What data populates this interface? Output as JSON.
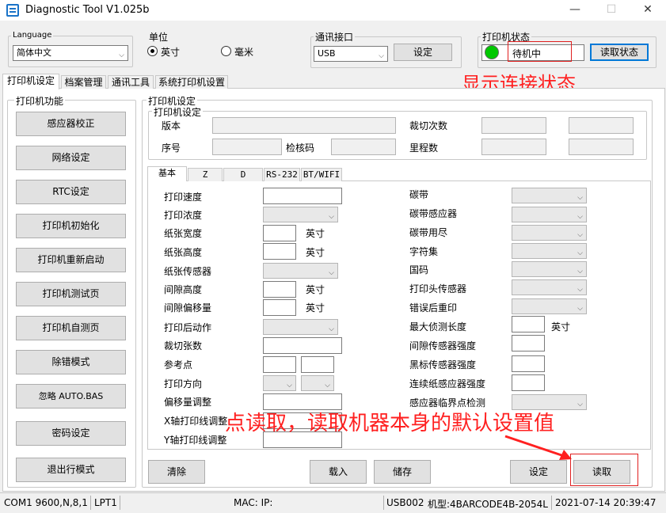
{
  "window": {
    "title": "Diagnostic Tool V1.025b",
    "min": "—",
    "max": "☐",
    "close": "✕"
  },
  "top": {
    "language": {
      "label": "Language",
      "value": "简体中文"
    },
    "unit": {
      "label": "单位",
      "inch": "英寸",
      "mm": "毫米",
      "selected": "inch"
    },
    "comm": {
      "label": "通讯接口",
      "value": "USB",
      "set_btn": "设定"
    },
    "status": {
      "label": "打印机状态",
      "value": "待机中",
      "read_btn": "读取状态",
      "led_color": "#00c800"
    }
  },
  "tabs": [
    "打印机设定",
    "档案管理",
    "通讯工具",
    "系统打印机设置"
  ],
  "annotations": {
    "status": "显示连接状态",
    "read": "点读取，读取机器本身的默认设置值"
  },
  "left": {
    "title": "打印机功能",
    "buttons": [
      "感应器校正",
      "网络设定",
      "RTC设定",
      "打印机初始化",
      "打印机重新启动",
      "打印机测试页",
      "打印机自测页",
      "除错模式",
      "忽略 AUTO.BAS",
      "密码设定",
      "退出行模式"
    ]
  },
  "printer_settings": {
    "outer_title": "打印机设定",
    "inner_title": "打印机设定",
    "version": "版本",
    "serial": "序号",
    "checksum": "检核码",
    "cut_count": "裁切次数",
    "mileage": "里程数"
  },
  "subtabs": [
    "基本",
    "Z",
    "D",
    "RS-232",
    "BT/WIFI"
  ],
  "basic": {
    "left_labels": [
      "打印速度",
      "打印浓度",
      "纸张宽度",
      "纸张高度",
      "纸张传感器",
      "间隙高度",
      "间隙偏移量",
      "打印后动作",
      "裁切张数",
      "参考点",
      "打印方向",
      "偏移量调整",
      "X轴打印线调整",
      "Y轴打印线调整"
    ],
    "unit": "英寸",
    "right_labels": [
      "碳带",
      "碳带感应器",
      "碳带用尽",
      "字符集",
      "国码",
      "打印头传感器",
      "错误后重印",
      "最大侦测长度",
      "间隙传感器强度",
      "黑标传感器强度",
      "连续纸感应器强度",
      "感应器临界点检测"
    ],
    "max_detect_unit": "英寸"
  },
  "bottom_buttons": {
    "clear": "清除",
    "load": "载入",
    "save": "储存",
    "set": "设定",
    "read": "读取"
  },
  "statusbar": {
    "port": "COM1 9600,N,8,1",
    "lpt": "LPT1",
    "mac": "MAC: IP:",
    "usb": "USB002",
    "model": "机型:4BARCODE4B-2054L",
    "datetime": "2021-07-14 20:39:47"
  }
}
